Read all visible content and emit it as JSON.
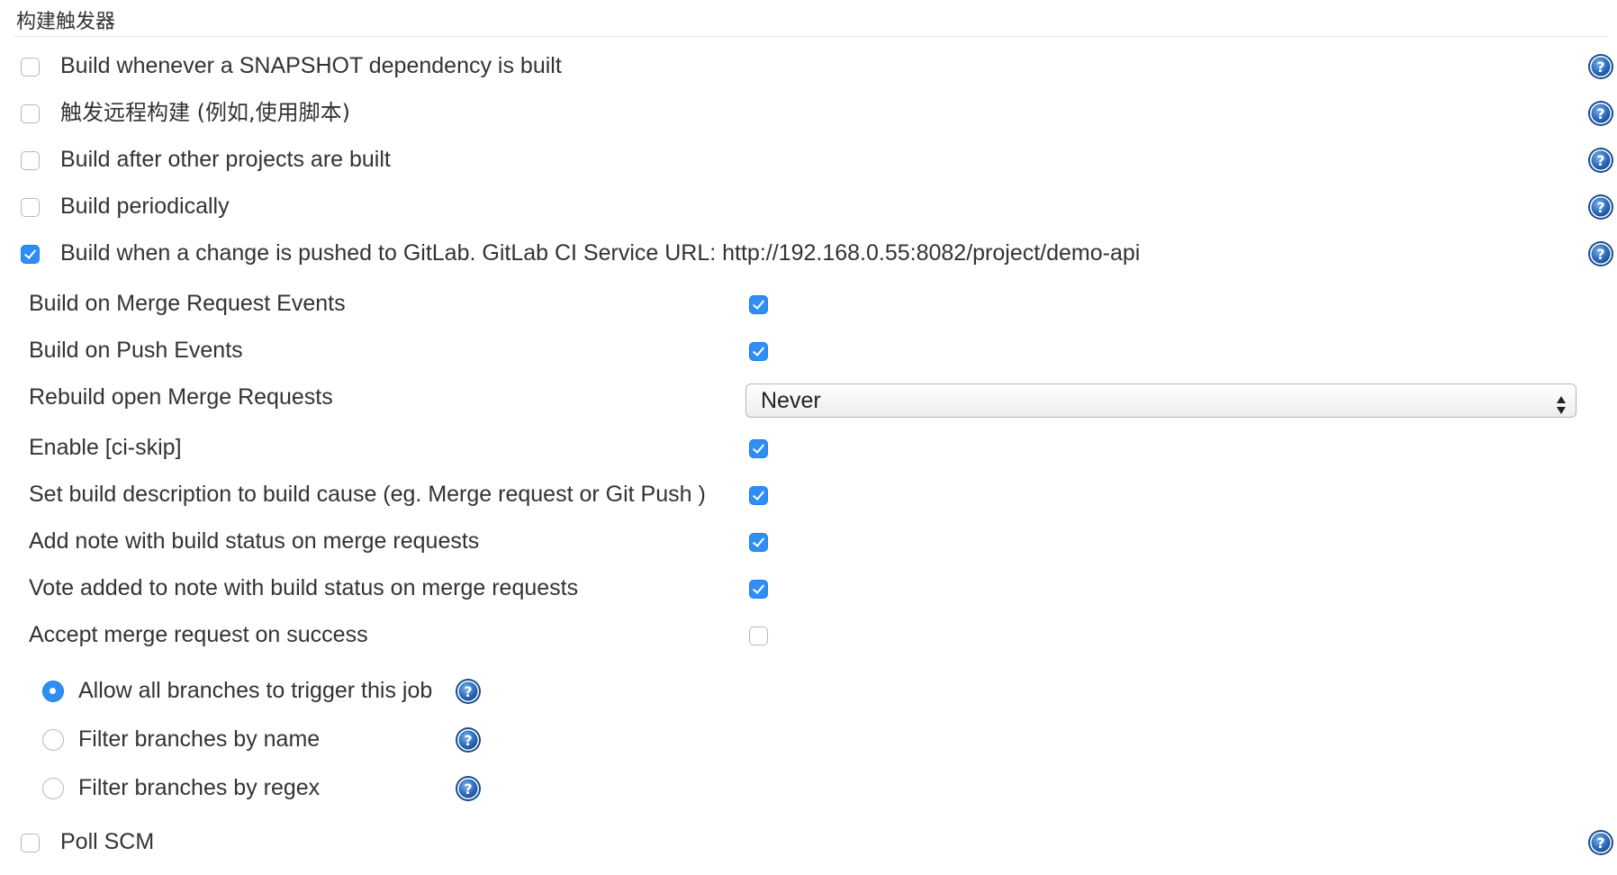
{
  "section": {
    "title": "构建触发器"
  },
  "triggers": [
    {
      "label": "Build whenever a SNAPSHOT dependency is built",
      "checked": false
    },
    {
      "label": "触发远程构建 (例如,使用脚本)",
      "checked": false
    },
    {
      "label": "Build after other projects are built",
      "checked": false
    },
    {
      "label": "Build periodically",
      "checked": false
    },
    {
      "label": "Build when a change is pushed to GitLab. GitLab CI Service URL: http://192.168.0.55:8082/project/demo-api",
      "checked": true
    },
    {
      "label": "Poll SCM",
      "checked": false
    }
  ],
  "gitlab_options": [
    {
      "label": "Build on Merge Request Events",
      "checked": true
    },
    {
      "label": "Build on Push Events",
      "checked": true
    },
    {
      "label": "Rebuild open Merge Requests",
      "select_value": "Never"
    },
    {
      "label": "Enable [ci-skip]",
      "checked": true
    },
    {
      "label": "Set build description to build cause (eg. Merge request or Git Push )",
      "checked": true
    },
    {
      "label": "Add note with build status on merge requests",
      "checked": true
    },
    {
      "label": "Vote added to note with build status on merge requests",
      "checked": true
    },
    {
      "label": "Accept merge request on success",
      "checked": false
    }
  ],
  "branch_filter": [
    {
      "label": "Allow all branches to trigger this job",
      "selected": true
    },
    {
      "label": "Filter branches by name",
      "selected": false
    },
    {
      "label": "Filter branches by regex",
      "selected": false
    }
  ],
  "icons": {
    "help": "help-icon",
    "select_arrows": "select-arrows-icon"
  },
  "colors": {
    "accent": "#2f8ef5",
    "help_blue": "#1d5fa8"
  }
}
